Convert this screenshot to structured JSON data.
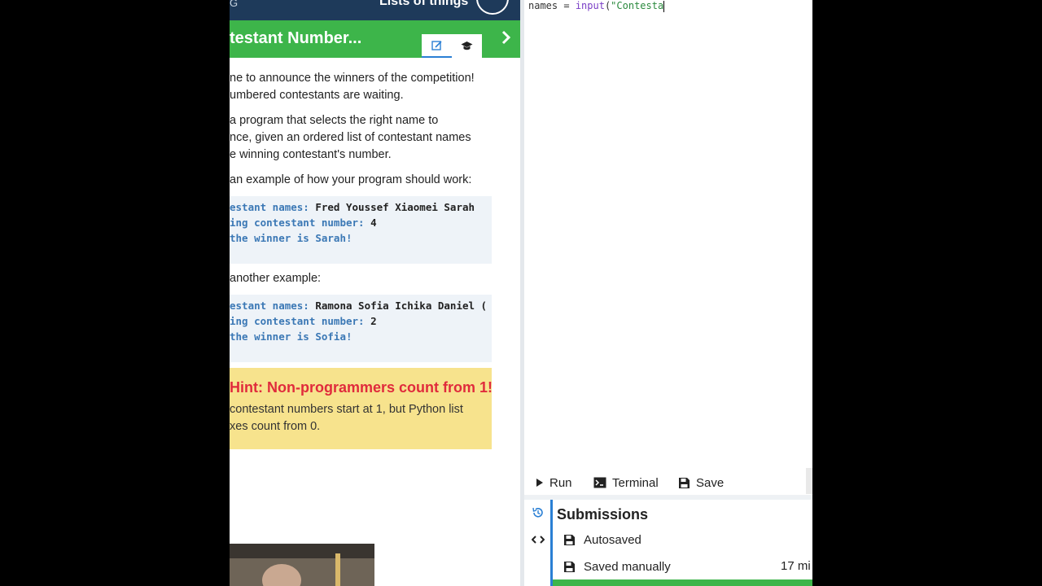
{
  "header": {
    "crumb": "G",
    "course_title": "Lists of things",
    "exercise_title": "testant Number..."
  },
  "lesson": {
    "paragraphs": [
      "ne to announce the winners of the competition!",
      "umbered contestants are waiting.",
      "a program that selects the right name to",
      "nce, given an ordered list of contestant names",
      "e winning contestant's number.",
      "an example of how your program should work:"
    ],
    "example1": {
      "lines": [
        {
          "prompt": "estant names: ",
          "input": "Fred Youssef Xiaomei Sarah"
        },
        {
          "prompt": "ing contestant number: ",
          "input": "4"
        },
        {
          "prompt": "the winner is Sarah!",
          "input": ""
        }
      ]
    },
    "another_example": "another example:",
    "example2": {
      "lines": [
        {
          "prompt": "estant names: ",
          "input": "Ramona Sofia Ichika Daniel ("
        },
        {
          "prompt": "ing contestant number: ",
          "input": "2"
        },
        {
          "prompt": "the winner is Sofia!",
          "input": ""
        }
      ]
    },
    "hint": {
      "title": "Hint: Non-programmers count from 1!",
      "lines": [
        "contestant numbers start at 1, but Python list",
        "xes count from 0."
      ]
    }
  },
  "editor": {
    "code": {
      "var": "names",
      "op": " = ",
      "fn": "input",
      "paren": "(",
      "str": "\"Contesta"
    }
  },
  "toolbar": {
    "run_label": "Run",
    "terminal_label": "Terminal",
    "save_label": "Save"
  },
  "submissions": {
    "title": "Submissions",
    "autosaved_label": "Autosaved",
    "saved_manually_label": "Saved manually",
    "saved_manually_time": "17 mi"
  },
  "colors": {
    "header_bg": "#1e3a5a",
    "green": "#3db54a",
    "hint_bg": "#f7e38d",
    "hint_title": "#e02b3c",
    "code_bg": "#eef3f8",
    "accent_blue": "#2a7fd4"
  },
  "icons": {
    "edit_tab": "edit-icon",
    "learn_tab": "mortarboard-icon",
    "next": "chevron-right-icon",
    "run": "play-icon",
    "terminal": "terminal-icon",
    "save": "floppy-disk-icon",
    "history": "history-icon",
    "code": "code-icon"
  }
}
